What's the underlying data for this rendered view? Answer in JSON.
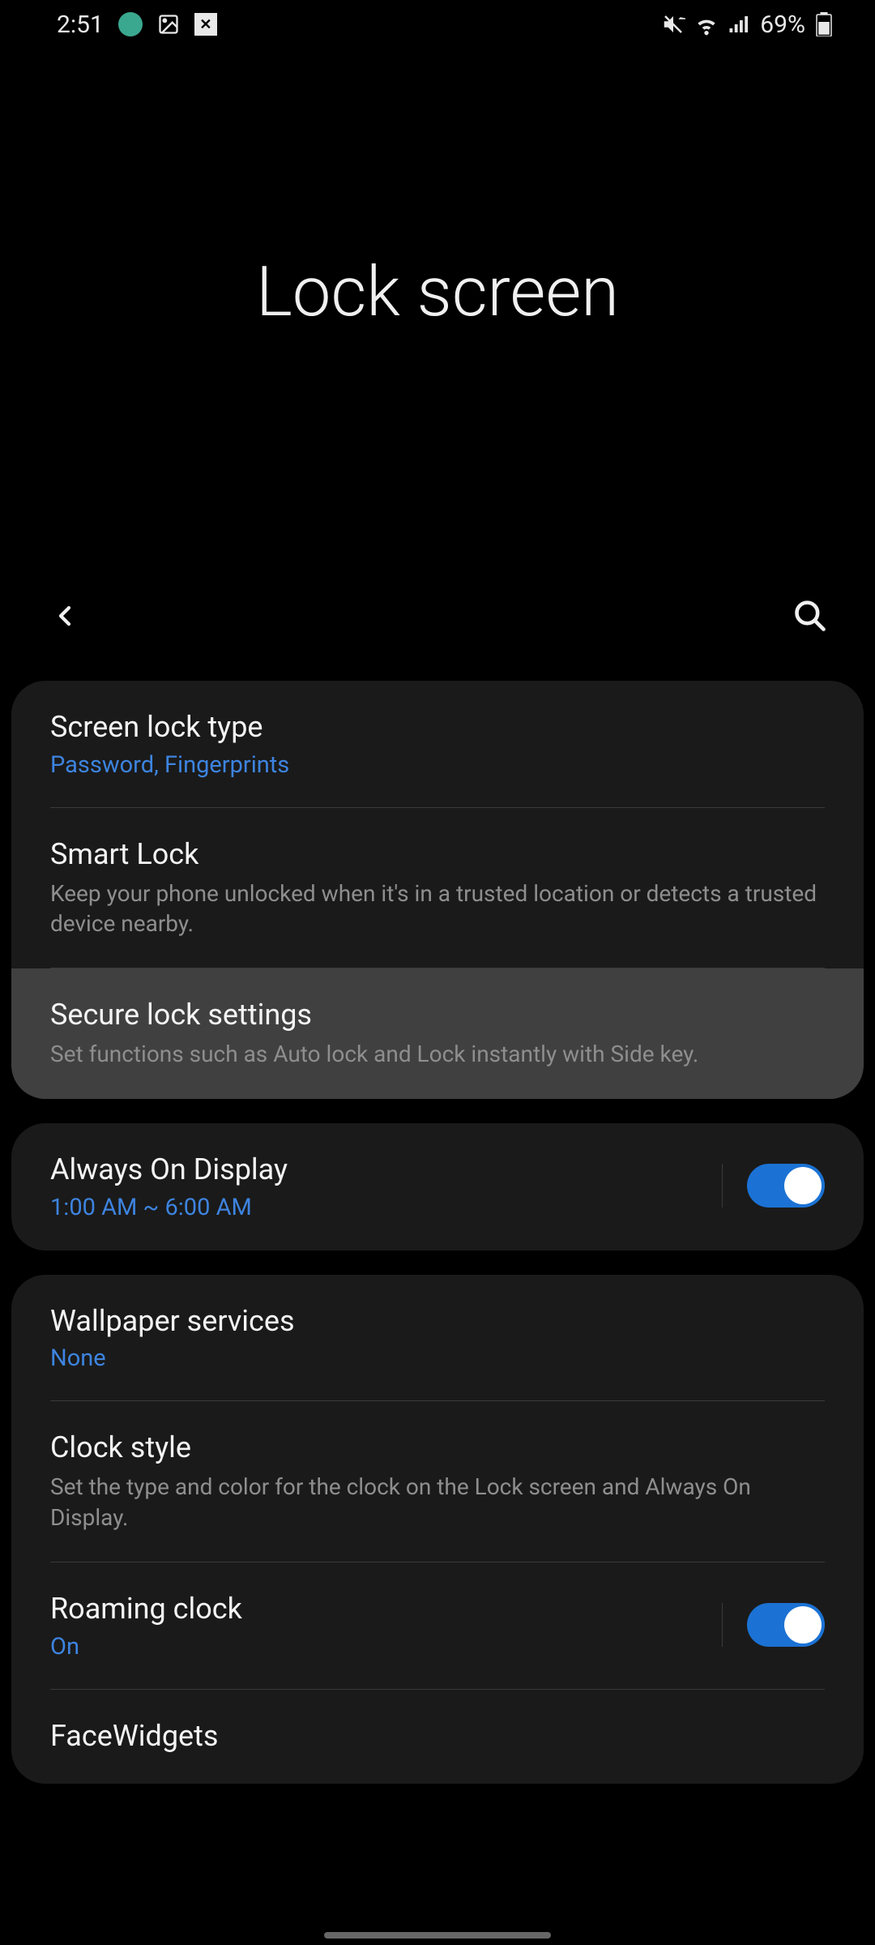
{
  "status": {
    "time": "2:51",
    "battery": "69%"
  },
  "header": {
    "title": "Lock screen"
  },
  "groups": [
    {
      "items": [
        {
          "title": "Screen lock type",
          "sub": "Password, Fingerprints",
          "subStyle": "blue",
          "sep": true,
          "hl": false
        },
        {
          "title": "Smart Lock",
          "sub": "Keep your phone unlocked when it's in a trusted location or detects a trusted device nearby.",
          "subStyle": "grey",
          "sep": true,
          "hl": false
        },
        {
          "title": "Secure lock settings",
          "sub": "Set functions such as Auto lock and Lock instantly with Side key.",
          "subStyle": "grey",
          "sep": false,
          "hl": true
        }
      ]
    },
    {
      "items": [
        {
          "title": "Always On Display",
          "sub": "1:00 AM ~ 6:00 AM",
          "subStyle": "blue",
          "toggle": true,
          "toggleOn": true,
          "sep": false,
          "hl": false
        }
      ]
    },
    {
      "items": [
        {
          "title": "Wallpaper services",
          "sub": "None",
          "subStyle": "blue",
          "sep": true,
          "hl": false
        },
        {
          "title": "Clock style",
          "sub": "Set the type and color for the clock on the Lock screen and Always On Display.",
          "subStyle": "grey",
          "sep": true,
          "hl": false
        },
        {
          "title": "Roaming clock",
          "sub": "On",
          "subStyle": "blue",
          "toggle": true,
          "toggleOn": true,
          "sep": true,
          "hl": false
        },
        {
          "title": "FaceWidgets",
          "sub": "",
          "subStyle": "grey",
          "sep": false,
          "hl": false
        }
      ]
    }
  ]
}
